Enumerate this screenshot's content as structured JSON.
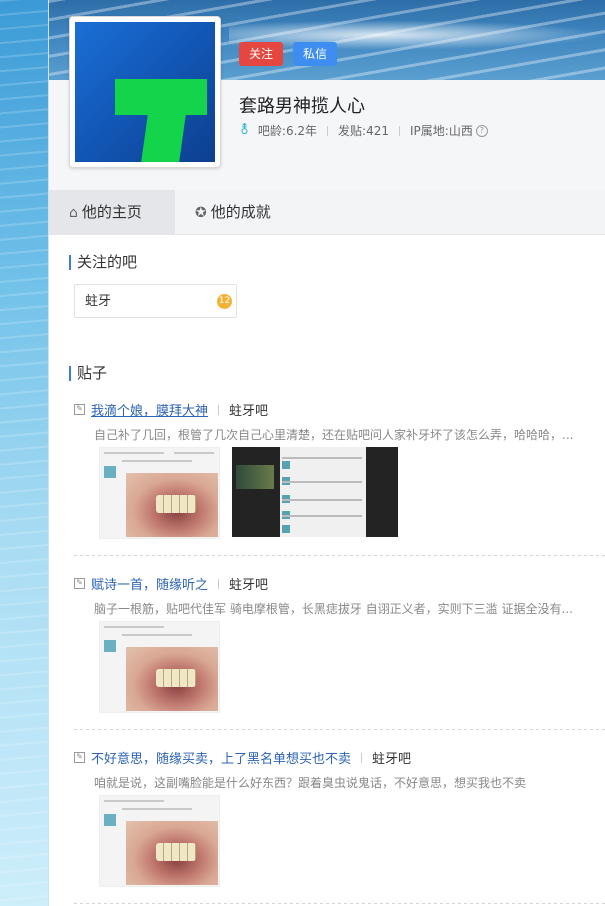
{
  "profile": {
    "follow_label": "关注",
    "message_label": "私信",
    "username": "套路男神揽人心",
    "gender_icon": "male-female-symbol-icon",
    "age": "吧龄:6.2年",
    "posts": "发贴:421",
    "ip": "IP属地:山西"
  },
  "tabs": {
    "home": "他的主页",
    "achievements": "他的成就"
  },
  "followed_forums": {
    "title": "关注的吧",
    "items": [
      {
        "name": "蛀牙",
        "badge": "12"
      }
    ]
  },
  "posts_section": {
    "title": "贴子",
    "items": [
      {
        "title": "我滴个娘，膜拜大神",
        "forum": "蛀牙吧",
        "desc": "自己补了几回，根管了几次自己心里清楚，还在贴吧问人家补牙坏了该怎么弄，哈哈哈，..."
      },
      {
        "title": "赋诗一首，随缘听之",
        "forum": "蛀牙吧",
        "desc": "脑子一根筋，贴吧代佳军 骑电摩根管，长黑痣拔牙 自诩正义者，实则下三滥 证据全没有..."
      },
      {
        "title": "不好意思，随缘买卖，上了黑名单想买也不卖",
        "forum": "蛀牙吧",
        "desc": "咱就是说，这副嘴脸能是什么好东西？跟着臭虫说鬼话，不好意思，想买我也不卖"
      }
    ]
  },
  "colors": {
    "follow_btn": "#e5463f",
    "message_btn": "#3d8ef0",
    "link_blue": "#2d64b3",
    "accent_green": "#13d44a"
  }
}
